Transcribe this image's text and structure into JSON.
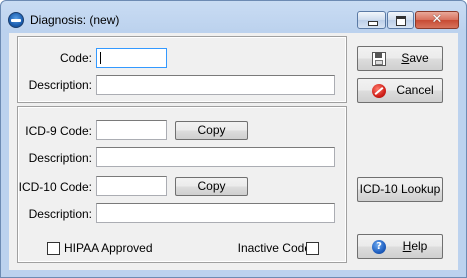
{
  "window": {
    "title": "Diagnosis: (new)",
    "close_glyph": "✕"
  },
  "code": {
    "label": "Code:",
    "value": ""
  },
  "description1": {
    "label": "Description:",
    "value": ""
  },
  "icd9": {
    "label": "ICD-9 Code:",
    "value": "",
    "copy_label": "Copy"
  },
  "description2": {
    "label": "Description:",
    "value": ""
  },
  "icd10": {
    "label": "ICD-10 Code:",
    "value": "",
    "copy_label": "Copy"
  },
  "description3": {
    "label": "Description:",
    "value": ""
  },
  "hipaa": {
    "label": "HIPAA Approved",
    "checked": false
  },
  "inactive": {
    "label": "Inactive Code",
    "checked": false
  },
  "buttons": {
    "save": "Save",
    "cancel": "Cancel",
    "lookup": "ICD-10 Lookup",
    "help": "Help",
    "help_glyph": "?"
  },
  "icons": [
    "app-icon",
    "minimize-icon",
    "maximize-icon",
    "close-icon",
    "save-icon",
    "cancel-icon",
    "help-icon"
  ]
}
